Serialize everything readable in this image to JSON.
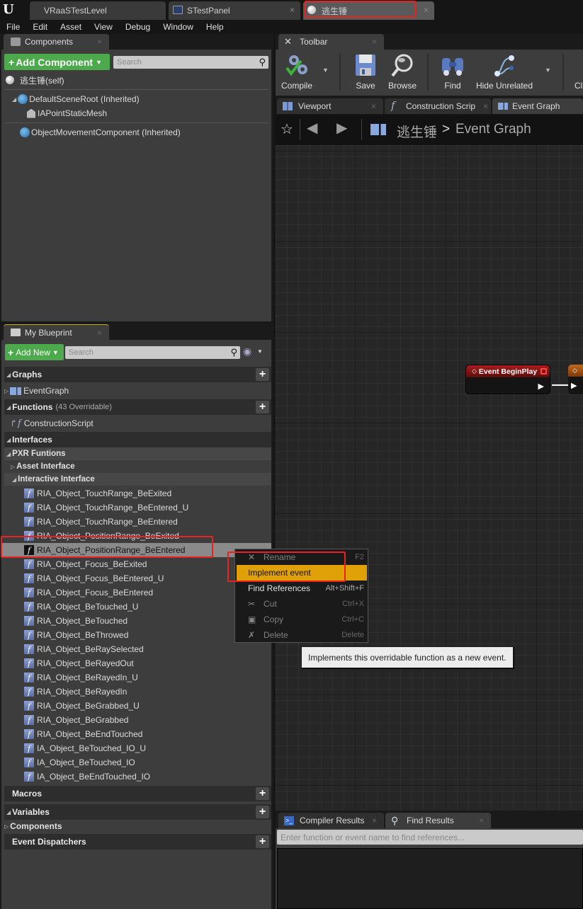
{
  "title_tabs": [
    {
      "label": "VRaaSTestLevel",
      "icon": "level-icon"
    },
    {
      "label": "STestPanel",
      "icon": "widget-icon",
      "close": "×"
    },
    {
      "label": "逃生锤",
      "icon": "blueprint-sphere-icon",
      "close": "×"
    }
  ],
  "menu": [
    "File",
    "Edit",
    "Asset",
    "View",
    "Debug",
    "Window",
    "Help"
  ],
  "components_panel": {
    "tab": "Components",
    "close": "×",
    "add_button": "Add Component",
    "search_placeholder": "Search",
    "tree": [
      {
        "label": "逃生锤(self)",
        "icon": "sphere-icon"
      },
      {
        "label": "DefaultSceneRoot (Inherited)",
        "icon": "scene-root-icon"
      },
      {
        "label": "IAPointStaticMesh",
        "icon": "static-mesh-icon"
      },
      {
        "label": "ObjectMovementComponent (Inherited)",
        "icon": "component-icon"
      }
    ]
  },
  "toolbar": {
    "tab": "Toolbar",
    "close": "×",
    "buttons": [
      {
        "label": "Compile",
        "icon": "compile-icon"
      },
      {
        "label": "Save",
        "icon": "save-icon"
      },
      {
        "label": "Browse",
        "icon": "browse-icon"
      },
      {
        "label": "Find",
        "icon": "find-icon"
      },
      {
        "label": "Hide Unrelated",
        "icon": "hide-unrelated-icon"
      },
      {
        "label": "Cl"
      }
    ]
  },
  "editor_tabs": [
    {
      "label": "Viewport",
      "close": "×"
    },
    {
      "label": "Construction Scrip",
      "close": "×"
    },
    {
      "label": "Event Graph"
    }
  ],
  "graph": {
    "breadcrumb_root": "逃生锤",
    "breadcrumb_sep": ">",
    "breadcrumb_current": "Event Graph",
    "node_title": "Event BeginPlay"
  },
  "my_blueprint": {
    "tab": "My Blueprint",
    "close": "×",
    "add_button": "Add New",
    "search_placeholder": "Search",
    "graphs_label": "Graphs",
    "event_graph": "EventGraph",
    "functions_label": "Functions",
    "functions_count": "(43 Overridable)",
    "construction_script": "ConstructionScript",
    "interfaces_label": "Interfaces",
    "pxr_label": "PXR Funtions",
    "asset_interface": "Asset Interface",
    "interactive_interface": "Interactive Interface",
    "functions": [
      "RIA_Object_TouchRange_BeExited",
      "RIA_Object_TouchRange_BeEntered_U",
      "RIA_Object_TouchRange_BeEntered",
      "RIA_Object_PositionRange_BeExited",
      "RIA_Object_PositionRange_BeEntered",
      "RIA_Object_Focus_BeExited",
      "RIA_Object_Focus_BeEntered_U",
      "RIA_Object_Focus_BeEntered",
      "RIA_Object_BeTouched_U",
      "RIA_Object_BeTouched",
      "RIA_Object_BeThrowed",
      "RIA_Object_BeRaySelected",
      "RIA_Object_BeRayedOut",
      "RIA_Object_BeRayedIn_U",
      "RIA_Object_BeRayedIn",
      "RIA_Object_BeGrabbed_U",
      "RIA_Object_BeGrabbed",
      "RIA_Object_BeEndTouched",
      "IA_Object_BeTouched_IO_U",
      "IA_Object_BeTouched_IO",
      "IA_Object_BeEndTouched_IO"
    ],
    "selected_index": 4,
    "macros_label": "Macros",
    "variables_label": "Variables",
    "components_label": "Components",
    "dispatchers_label": "Event Dispatchers"
  },
  "context_menu": {
    "items": [
      {
        "label": "Rename",
        "shortcut": "F2",
        "enabled": false,
        "icon": "rename-icon"
      },
      {
        "label": "Implement event",
        "shortcut": "",
        "enabled": true,
        "highlighted": true
      },
      {
        "label": "Find References",
        "shortcut": "Alt+Shift+F",
        "enabled": true
      },
      {
        "label": "Cut",
        "shortcut": "Ctrl+X",
        "enabled": false,
        "icon": "cut-icon"
      },
      {
        "label": "Copy",
        "shortcut": "Ctrl+C",
        "enabled": false,
        "icon": "copy-icon"
      },
      {
        "label": "Delete",
        "shortcut": "Delete",
        "enabled": false,
        "icon": "delete-icon"
      }
    ],
    "tooltip": "Implements this overridable function as a new event."
  },
  "bottom": {
    "tabs": [
      {
        "label": "Compiler Results",
        "close": "×"
      },
      {
        "label": "Find Results",
        "close": "×"
      }
    ],
    "find_placeholder": "Enter function or event name to find references..."
  },
  "colors": {
    "accent_green": "#4caa4c",
    "highlight": "#e0a008",
    "annotation_red": "#e8221c",
    "event_node_red": "#8a1414"
  }
}
